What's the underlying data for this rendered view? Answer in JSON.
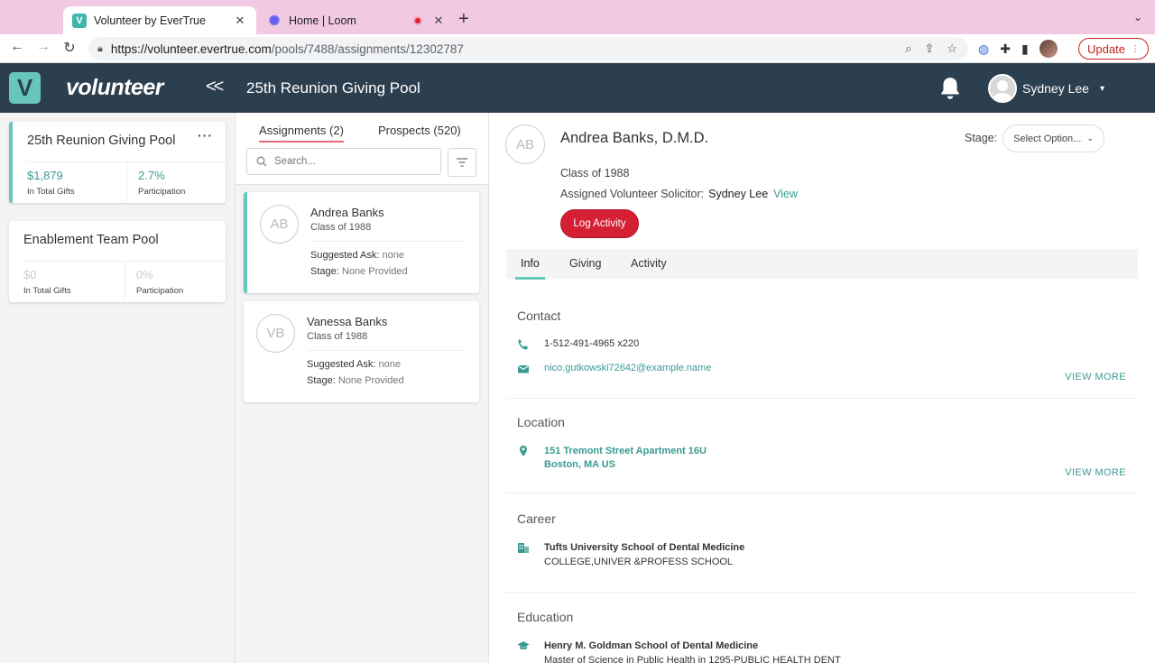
{
  "browser": {
    "tabs": [
      {
        "title": "Volunteer by EverTrue",
        "favicon": "V"
      },
      {
        "title": "Home | Loom"
      }
    ],
    "url_host": "https://volunteer.evertrue.com",
    "url_path": "/pools/7488/assignments/12302787",
    "update_label": "Update"
  },
  "header": {
    "wordmark": "volunteer",
    "collapse_label": "<<",
    "pool_title": "25th Reunion Giving Pool",
    "user_name": "Sydney Lee"
  },
  "pools": [
    {
      "name": "25th Reunion Giving Pool",
      "total_gifts": "$1,879",
      "total_gifts_label": "In Total Gifts",
      "participation": "2.7%",
      "participation_label": "Participation"
    },
    {
      "name": "Enablement Team Pool",
      "total_gifts": "$0",
      "total_gifts_label": "In Total Gifts",
      "participation": "0%",
      "participation_label": "Participation"
    }
  ],
  "pool_menu": "···",
  "middle": {
    "tab_assignments": "Assignments (2)",
    "tab_prospects": "Prospects (520)",
    "search_placeholder": "Search...",
    "prospects": [
      {
        "initials": "AB",
        "name": "Andrea Banks",
        "class": "Class of 1988",
        "ask_label": "Suggested Ask:",
        "ask_value": "none",
        "stage_label": "Stage:",
        "stage_value": "None Provided"
      },
      {
        "initials": "VB",
        "name": "Vanessa Banks",
        "class": "Class of 1988",
        "ask_label": "Suggested Ask:",
        "ask_value": "none",
        "stage_label": "Stage:",
        "stage_value": "None Provided"
      }
    ]
  },
  "detail": {
    "initials": "AB",
    "name": "Andrea Banks, D.M.D.",
    "class": "Class of 1988",
    "solicitor_label": "Assigned Volunteer Solicitor:",
    "solicitor_name": "Sydney Lee",
    "solicitor_view": "View",
    "log_activity": "Log Activity",
    "stage_label": "Stage:",
    "stage_select": "Select Option...",
    "tabs": [
      "Info",
      "Giving",
      "Activity"
    ],
    "view_more": "VIEW MORE",
    "contact": {
      "heading": "Contact",
      "phone": "1-512-491-4965 x220",
      "email": "nico.gutkowski72642@example.name"
    },
    "location": {
      "heading": "Location",
      "line1": "151 Tremont Street Apartment 16U",
      "line2": "Boston, MA US"
    },
    "career": {
      "heading": "Career",
      "employer": "Tufts University School of Dental Medicine",
      "type": "COLLEGE,UNIVER &PROFESS SCHOOL"
    },
    "education": {
      "heading": "Education",
      "school": "Henry M. Goldman School of Dental Medicine",
      "degree": "Master of Science in Public Health in 1295-PUBLIC HEALTH DENT"
    }
  },
  "colors": {
    "accent": "#67c7bd",
    "header_bg": "#2c3f4f",
    "log_btn": "#d41f35",
    "tab_underline": "#e46b75"
  }
}
